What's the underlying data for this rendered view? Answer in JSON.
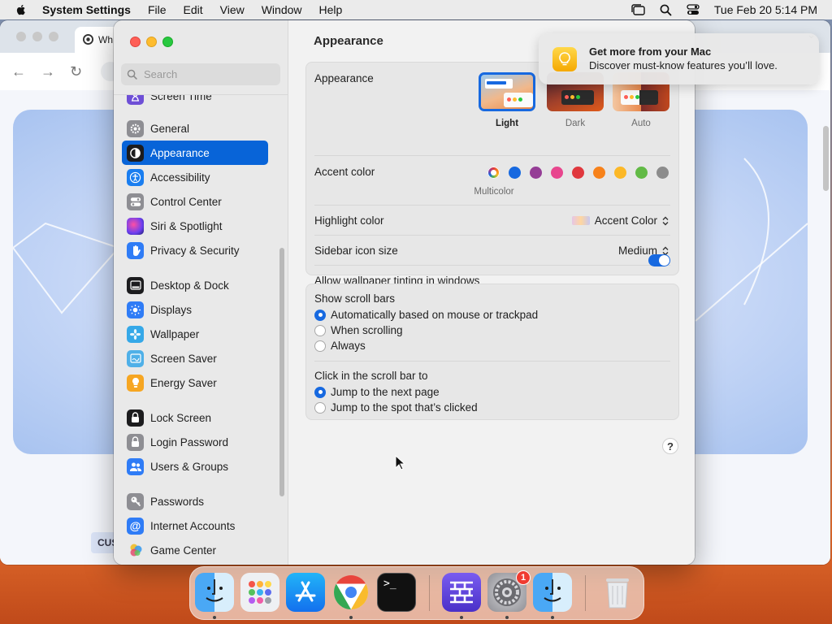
{
  "menubar": {
    "app_name": "System Settings",
    "items": [
      "File",
      "Edit",
      "View",
      "Window",
      "Help"
    ],
    "clock": "Tue Feb 20  5:14 PM"
  },
  "browser": {
    "tab_title": "Wh",
    "hero_button": "CUS"
  },
  "sidebar": {
    "search_placeholder": "Search",
    "items": [
      {
        "label": "Screen Time",
        "icon": "hourglass-icon",
        "color": "#6e4fd6"
      },
      {
        "label": "General",
        "icon": "gear-icon",
        "color": "#8e8e93"
      },
      {
        "label": "Appearance",
        "icon": "appearance-icon",
        "color": "#1c1c1e",
        "selected": true
      },
      {
        "label": "Accessibility",
        "icon": "accessibility-icon",
        "color": "#1a7ef0"
      },
      {
        "label": "Control Center",
        "icon": "control-center-icon",
        "color": "#8e8e93"
      },
      {
        "label": "Siri & Spotlight",
        "icon": "siri-icon",
        "color": "#b449d6"
      },
      {
        "label": "Privacy & Security",
        "icon": "hand-icon",
        "color": "#2f7cf6"
      },
      {
        "label": "Desktop & Dock",
        "icon": "dock-icon",
        "color": "#1c1c1e"
      },
      {
        "label": "Displays",
        "icon": "sun-icon",
        "color": "#2f7cf6"
      },
      {
        "label": "Wallpaper",
        "icon": "wallpaper-icon",
        "color": "#35a8e8"
      },
      {
        "label": "Screen Saver",
        "icon": "screen-saver-icon",
        "color": "#4fb0e8"
      },
      {
        "label": "Energy Saver",
        "icon": "lightbulb-icon",
        "color": "#f6a622"
      },
      {
        "label": "Lock Screen",
        "icon": "lock-icon",
        "color": "#1c1c1e"
      },
      {
        "label": "Login Password",
        "icon": "lock-icon",
        "color": "#8e8e93"
      },
      {
        "label": "Users & Groups",
        "icon": "users-icon",
        "color": "#2f7cf6"
      },
      {
        "label": "Passwords",
        "icon": "key-icon",
        "color": "#8e8e93"
      },
      {
        "label": "Internet Accounts",
        "icon": "at-icon",
        "color": "#2f7cf6"
      },
      {
        "label": "Game Center",
        "icon": "game-center-icon",
        "color": "#e24c6e"
      }
    ]
  },
  "content": {
    "title": "Appearance",
    "appearance": {
      "label": "Appearance",
      "options": [
        {
          "label": "Light",
          "selected": true
        },
        {
          "label": "Dark",
          "selected": false
        },
        {
          "label": "Auto",
          "selected": false
        }
      ]
    },
    "accent": {
      "label": "Accent color",
      "caption": "Multicolor",
      "colors": [
        "multicolor",
        "#1769e0",
        "#953d96",
        "#e8468e",
        "#e0383e",
        "#f7821b",
        "#fcb827",
        "#62ba46",
        "#8c8c8c"
      ]
    },
    "highlight": {
      "label": "Highlight color",
      "value": "Accent Color"
    },
    "sidebar_icon_size": {
      "label": "Sidebar icon size",
      "value": "Medium"
    },
    "wallpaper_tinting": {
      "label": "Allow wallpaper tinting in windows",
      "enabled": true
    },
    "scroll_bars": {
      "label": "Show scroll bars",
      "options": [
        {
          "label": "Automatically based on mouse or trackpad",
          "selected": true
        },
        {
          "label": "When scrolling",
          "selected": false
        },
        {
          "label": "Always",
          "selected": false
        }
      ]
    },
    "click_scroll": {
      "label": "Click in the scroll bar to",
      "options": [
        {
          "label": "Jump to the next page",
          "selected": true
        },
        {
          "label": "Jump to the spot that’s clicked",
          "selected": false
        }
      ]
    },
    "help": "?"
  },
  "notification": {
    "title": "Get more from your Mac",
    "body": "Discover must-know features you’ll love."
  },
  "dock": {
    "apps": [
      "Finder",
      "Launchpad",
      "App Store",
      "Google Chrome",
      "Terminal",
      "Wireshark",
      "System Settings",
      "Finder",
      "Trash"
    ],
    "settings_badge": "1"
  }
}
